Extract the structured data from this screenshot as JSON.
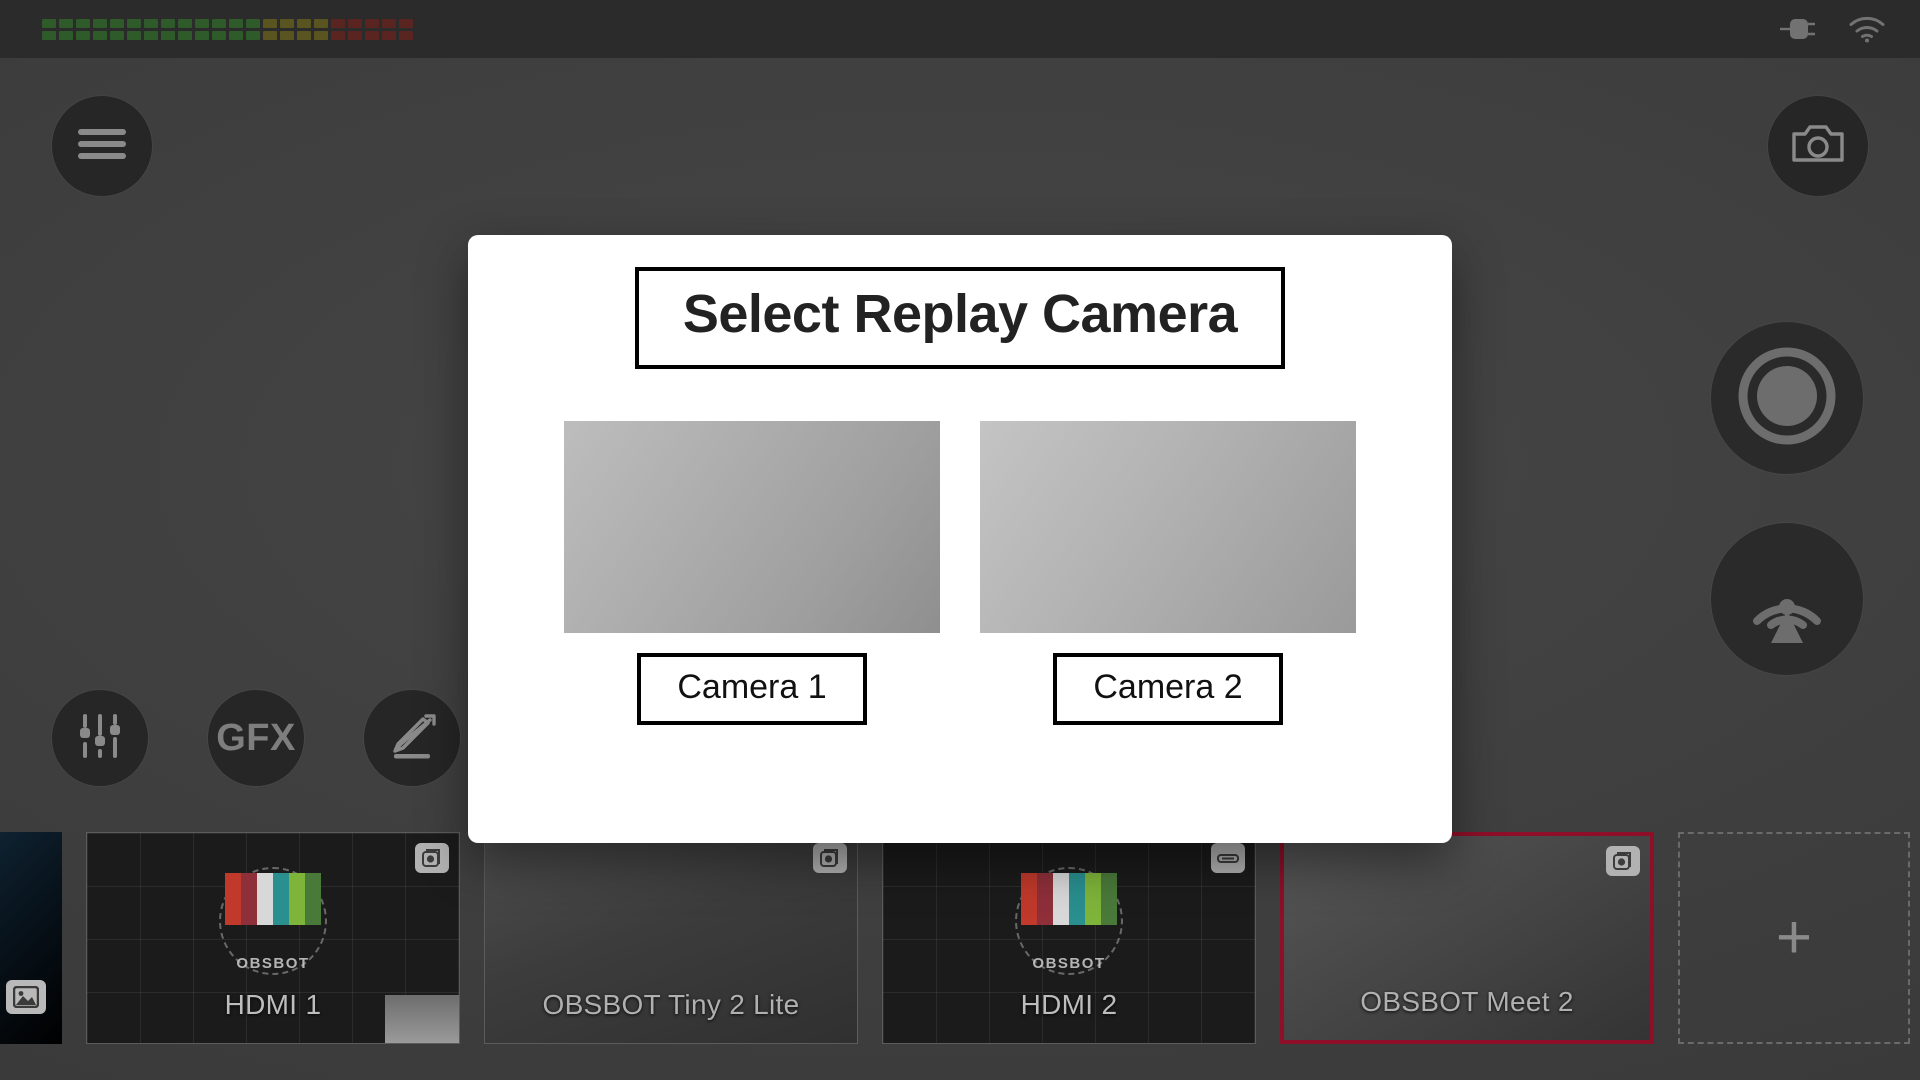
{
  "statusbar": {
    "audio_meter": {
      "rows": 2,
      "segments_per_row": 22,
      "green_count": 13,
      "yellow_count": 4,
      "red_count": 5,
      "green_color": "#2f5a2a",
      "yellow_color": "#5a5520",
      "red_color": "#5a2420"
    },
    "power_icon": "power-plug-icon",
    "wifi_icon": "wifi-icon"
  },
  "stage": {
    "menu_button": {
      "icon": "hamburger-menu-icon"
    },
    "snapshot_button": {
      "icon": "camera-icon"
    },
    "record_button": {
      "icon": "record-circle-icon"
    },
    "stream_button": {
      "icon": "broadcast-icon"
    },
    "mixer_button": {
      "icon": "audio-sliders-icon"
    },
    "gfx_button": {
      "label": "GFX",
      "icon": "gfx-text-icon"
    },
    "pen_button": {
      "icon": "pen-edit-icon"
    }
  },
  "source_strip": {
    "program_preview": {
      "icon": "image-placeholder-icon"
    },
    "sources": [
      {
        "label": "HDMI 1",
        "type": "hdmi",
        "badge_icon": "camera-badge-icon",
        "selected": false,
        "thumb": "grid"
      },
      {
        "label": "OBSBOT Tiny 2 Lite",
        "type": "usb",
        "badge_icon": "camera-badge-icon",
        "selected": false,
        "thumb": "plain"
      },
      {
        "label": "HDMI 2",
        "type": "hdmi",
        "badge_icon": "hdmi-badge-icon",
        "selected": false,
        "thumb": "grid"
      },
      {
        "label": "OBSBOT Meet 2",
        "type": "usb",
        "badge_icon": "camera-badge-icon",
        "selected": true,
        "thumb": "plain2"
      }
    ],
    "add_source_button": {
      "label": "+"
    },
    "selected_border_color": "#8e0f28"
  },
  "modal": {
    "title": "Select Replay Camera",
    "cameras": [
      {
        "label": "Camera 1"
      },
      {
        "label": "Camera 2"
      }
    ]
  }
}
